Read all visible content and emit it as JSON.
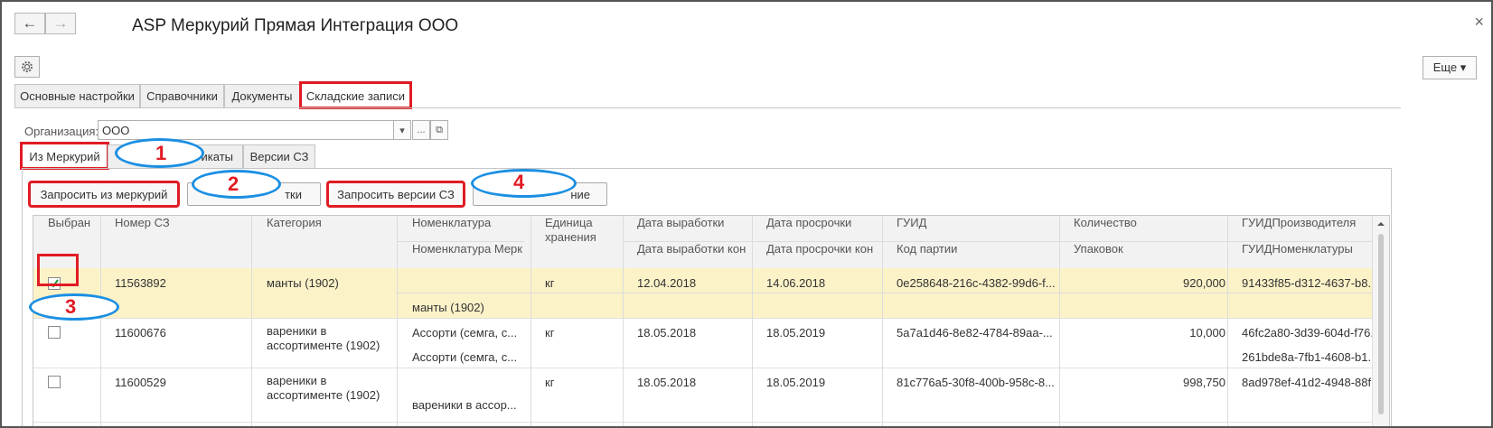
{
  "window": {
    "title": "ASP Меркурий Прямая Интеграция ООО",
    "back_glyph": "←",
    "forward_glyph": "→",
    "close_glyph": "×"
  },
  "toolbar": {
    "more_label": "Еще ▾"
  },
  "main_tabs": [
    {
      "label": "Основные настройки"
    },
    {
      "label": "Справочники"
    },
    {
      "label": "Документы"
    },
    {
      "label": "Складские записи"
    }
  ],
  "organization": {
    "label": "Организация:",
    "value": "ООО",
    "dropdown_glyph": "▾",
    "select_glyph": "...",
    "open_glyph": "⧉"
  },
  "sub_tabs": [
    {
      "label": "Из Меркурий"
    },
    {
      "label": "икаты"
    },
    {
      "label": "Версии СЗ"
    }
  ],
  "buttons": {
    "request_mercury": "Запросить из меркурий",
    "button2_tail": "тки",
    "request_versions": "Запросить версии СЗ",
    "button4_tail": "ние"
  },
  "annotations": [
    "1",
    "2",
    "3",
    "4"
  ],
  "table": {
    "headers": {
      "selected": "Выбран",
      "number": "Номер СЗ",
      "category": "Категория",
      "nomenclature": "Номенклатура",
      "nomenclature_merc": "Номенклатура Мерк",
      "unit": "Единица хранения",
      "date_prod": "Дата выработки",
      "date_prod_end": "Дата выработки кон",
      "date_exp": "Дата просрочки",
      "date_exp_end": "Дата просрочки кон",
      "guid": "ГУИД",
      "batch_code": "Код партии",
      "quantity": "Количество",
      "packaging": "Упаковок",
      "guid_producer": "ГУИДПроизводителя",
      "guid_nomenclature": "ГУИДНоменклатуры"
    },
    "rows": [
      {
        "checked": true,
        "number": "11563892",
        "category": "манты (1902)",
        "nomenclature": "",
        "nomenclature_merc": "манты (1902)",
        "unit": "кг",
        "date_prod": "12.04.2018",
        "date_exp": "14.06.2018",
        "guid": "0e258648-216c-4382-99d6-f...",
        "quantity": "920,000",
        "guid_producer": "91433f85-d312-4637-b8...",
        "guid_nomenclature": ""
      },
      {
        "checked": false,
        "number": "11600676",
        "category": "вареники в ассортименте (1902)",
        "nomenclature": "Ассорти (семга, с...",
        "nomenclature_merc": "Ассорти (семга, с...",
        "unit": "кг",
        "date_prod": "18.05.2018",
        "date_exp": "18.05.2019",
        "guid": "5a7a1d46-8e82-4784-89aa-...",
        "quantity": "10,000",
        "guid_producer": "46fc2a80-3d39-604d-f76...",
        "guid_nomenclature": "261bde8a-7fb1-4608-b1..."
      },
      {
        "checked": false,
        "number": "11600529",
        "category": "вареники в ассортименте (1902)",
        "nomenclature": "",
        "nomenclature_merc": "вареники в ассор...",
        "unit": "кг",
        "date_prod": "18.05.2018",
        "date_exp": "18.05.2019",
        "guid": "81c776a5-30f8-400b-958c-8...",
        "quantity": "998,750",
        "guid_producer": "8ad978ef-41d2-4948-88f...",
        "guid_nomenclature": ""
      }
    ]
  },
  "colors": {
    "highlight": "#e01b24",
    "annotation_blue": "#1a8fe3",
    "selected_row": "#fbf2c8"
  }
}
